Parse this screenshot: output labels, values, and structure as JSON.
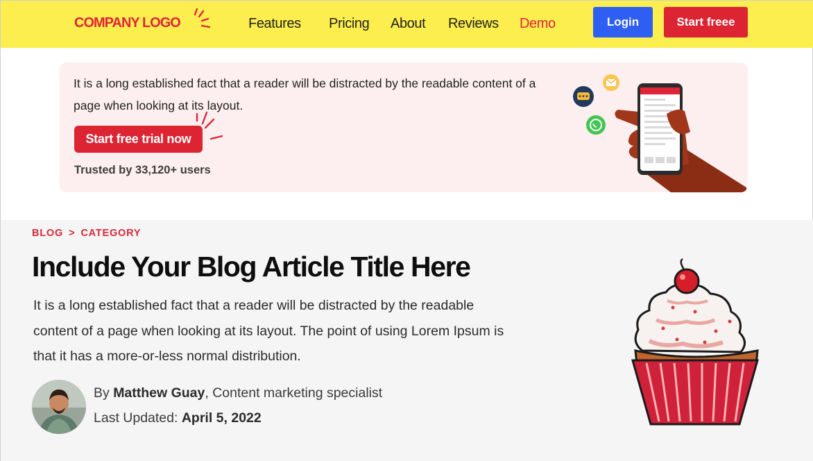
{
  "header": {
    "logo": "COMPANY LOGO",
    "nav": [
      {
        "label": "Features",
        "name": "nav-features",
        "highlight": false
      },
      {
        "label": "Pricing",
        "name": "nav-pricing",
        "highlight": false
      },
      {
        "label": "About",
        "name": "nav-about",
        "highlight": false
      },
      {
        "label": "Reviews",
        "name": "nav-reviews",
        "highlight": false
      },
      {
        "label": "Demo",
        "name": "nav-demo",
        "highlight": true
      }
    ],
    "login_label": "Login",
    "start_label": "Start freee"
  },
  "promo": {
    "text": "It is a long established fact that a reader will be distracted by the readable content of a page when looking at its layout.",
    "cta_label": "Start free trial now",
    "trusted": "Trusted by 33,120+ users"
  },
  "article": {
    "breadcrumb": [
      "BLOG",
      ">",
      "CATEGORY"
    ],
    "title": "Include Your Blog Article Title Here",
    "description": "It is a long established fact that a reader will be distracted by the readable content of a page when looking at its layout. The point of using Lorem Ipsum is that it has a more-or-less normal distribution.",
    "author": {
      "by": "By",
      "name": "Matthew Guay",
      "role": ", Content marketing specialist"
    },
    "updated_label": "Last Updated:",
    "updated_date": "April 5, 2022"
  },
  "colors": {
    "header_bg": "#fdee4f",
    "brand_red": "#dc2433",
    "login_blue": "#2f5ef2",
    "promo_bg": "#fdefef",
    "hero_bg": "#f5f5f5"
  },
  "icons": [
    "logo-burst-icon",
    "chat-bubble-icon",
    "mail-icon",
    "whatsapp-icon",
    "phone-in-hand-illustration",
    "cupcake-illustration"
  ]
}
